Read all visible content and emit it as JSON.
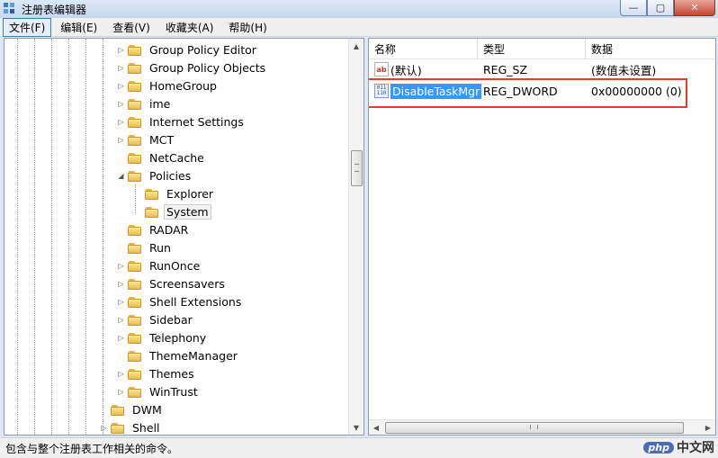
{
  "window": {
    "title": "注册表编辑器",
    "buttons": {
      "minimize": "—",
      "maximize": "▢",
      "close": "✕"
    }
  },
  "menu": [
    {
      "label": "文件(F)",
      "active": true
    },
    {
      "label": "编辑(E)",
      "active": false
    },
    {
      "label": "查看(V)",
      "active": false
    },
    {
      "label": "收藏夹(A)",
      "active": false
    },
    {
      "label": "帮助(H)",
      "active": false
    }
  ],
  "tree": {
    "nodes": [
      {
        "label": "Group Policy Editor",
        "level": 1,
        "expander": "collapsed"
      },
      {
        "label": "Group Policy Objects",
        "level": 1,
        "expander": "collapsed"
      },
      {
        "label": "HomeGroup",
        "level": 1,
        "expander": "collapsed"
      },
      {
        "label": "ime",
        "level": 1,
        "expander": "collapsed"
      },
      {
        "label": "Internet Settings",
        "level": 1,
        "expander": "collapsed"
      },
      {
        "label": "MCT",
        "level": 1,
        "expander": "collapsed"
      },
      {
        "label": "NetCache",
        "level": 1,
        "expander": "none"
      },
      {
        "label": "Policies",
        "level": 1,
        "expander": "expanded"
      },
      {
        "label": "Explorer",
        "level": 2,
        "expander": "none"
      },
      {
        "label": "System",
        "level": 2,
        "expander": "none",
        "selected": true
      },
      {
        "label": "RADAR",
        "level": 1,
        "expander": "none"
      },
      {
        "label": "Run",
        "level": 1,
        "expander": "none"
      },
      {
        "label": "RunOnce",
        "level": 1,
        "expander": "collapsed"
      },
      {
        "label": "Screensavers",
        "level": 1,
        "expander": "collapsed"
      },
      {
        "label": "Shell Extensions",
        "level": 1,
        "expander": "collapsed"
      },
      {
        "label": "Sidebar",
        "level": 1,
        "expander": "collapsed"
      },
      {
        "label": "Telephony",
        "level": 1,
        "expander": "collapsed"
      },
      {
        "label": "ThemeManager",
        "level": 1,
        "expander": "none"
      },
      {
        "label": "Themes",
        "level": 1,
        "expander": "collapsed"
      },
      {
        "label": "WinTrust",
        "level": 1,
        "expander": "collapsed"
      },
      {
        "label": "DWM",
        "level": 0,
        "expander": "none"
      },
      {
        "label": "Shell",
        "level": 0,
        "expander": "collapsed"
      }
    ]
  },
  "values": {
    "columns": {
      "name": "名称",
      "type": "类型",
      "data": "数据"
    },
    "rows": [
      {
        "icon": "string-value-icon",
        "icon_text": "ab",
        "name": "(默认)",
        "type": "REG_SZ",
        "data": "(数值未设置)",
        "selected": false
      },
      {
        "icon": "binary-value-icon",
        "icon_text": "011\n110",
        "name": "DisableTaskMgr",
        "type": "REG_DWORD",
        "data": "0x00000000 (0)",
        "selected": true
      }
    ],
    "highlight_color": "#e63a2e"
  },
  "status": {
    "text": "包含与整个注册表工作相关的命令。"
  },
  "watermark": {
    "badge": "php",
    "text": "中文网"
  }
}
